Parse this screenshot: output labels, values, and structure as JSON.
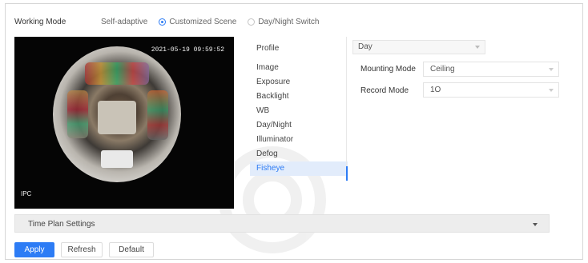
{
  "working_mode": {
    "label": "Working Mode",
    "options": [
      {
        "label": "Self-adaptive",
        "selected": false
      },
      {
        "label": "Customized Scene",
        "selected": true
      },
      {
        "label": "Day/Night Switch",
        "selected": false
      }
    ]
  },
  "preview": {
    "timestamp": "2021-05-19 09:59:52",
    "channel_label": "IPC"
  },
  "menu": {
    "profile_label": "Profile",
    "items": [
      "Image",
      "Exposure",
      "Backlight",
      "WB",
      "Day/Night",
      "Illuminator",
      "Defog",
      "Fisheye"
    ],
    "active": "Fisheye"
  },
  "config": {
    "profile_value": "Day",
    "mounting_mode_label": "Mounting Mode",
    "mounting_mode_value": "Ceiling",
    "record_mode_label": "Record Mode",
    "record_mode_value": "1O"
  },
  "time_plan": {
    "label": "Time Plan Settings"
  },
  "buttons": {
    "apply": "Apply",
    "refresh": "Refresh",
    "default": "Default"
  },
  "colors": {
    "accent": "#2d7cf5",
    "active_bg": "#e2ecfb"
  }
}
